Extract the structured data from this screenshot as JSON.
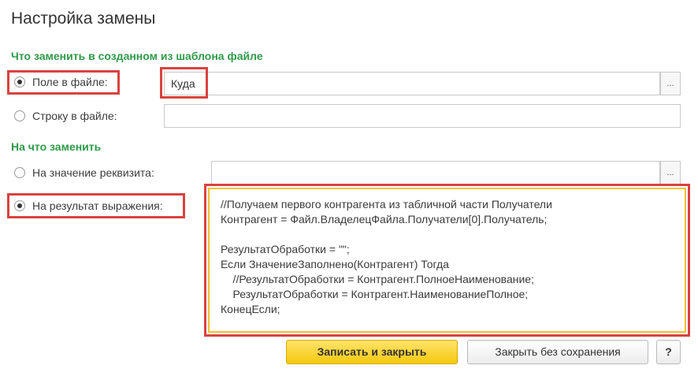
{
  "dialog": {
    "title": "Настройка замены"
  },
  "what_section": {
    "heading": "Что заменить в созданном из шаблона файле",
    "options": [
      {
        "label": "Поле в файле:",
        "selected": true,
        "value": "Куда",
        "ellipsis": "..."
      },
      {
        "label": "Строку в файле:",
        "selected": false,
        "value": ""
      }
    ]
  },
  "with_section": {
    "heading": "На что заменить",
    "options": [
      {
        "label": "На значение реквизита:",
        "selected": false,
        "value": "",
        "ellipsis": "..."
      },
      {
        "label": "На результат выражения:",
        "selected": true
      }
    ],
    "expression_lines": [
      "//Получаем первого контрагента из табличной части Получатели",
      "Контрагент = Файл.ВладелецФайла.Получатели[0].Получатель;",
      "",
      "РезультатОбработки = \"\";",
      "Если ЗначениеЗаполнено(Контрагент) Тогда",
      "    //РезультатОбработки = Контрагент.ПолноеНаименование;",
      "    РезультатОбработки = Контрагент.НаименованиеПолное;",
      "КонецЕсли;"
    ]
  },
  "footer": {
    "save_close": "Записать и закрыть",
    "close_no_save": "Закрыть без сохранения",
    "help": "?"
  },
  "colors": {
    "section_heading": "#2f9a48",
    "highlight_red": "#d9423f",
    "highlight_yellow": "#f2c12e",
    "primary_button": "#f6c810"
  }
}
